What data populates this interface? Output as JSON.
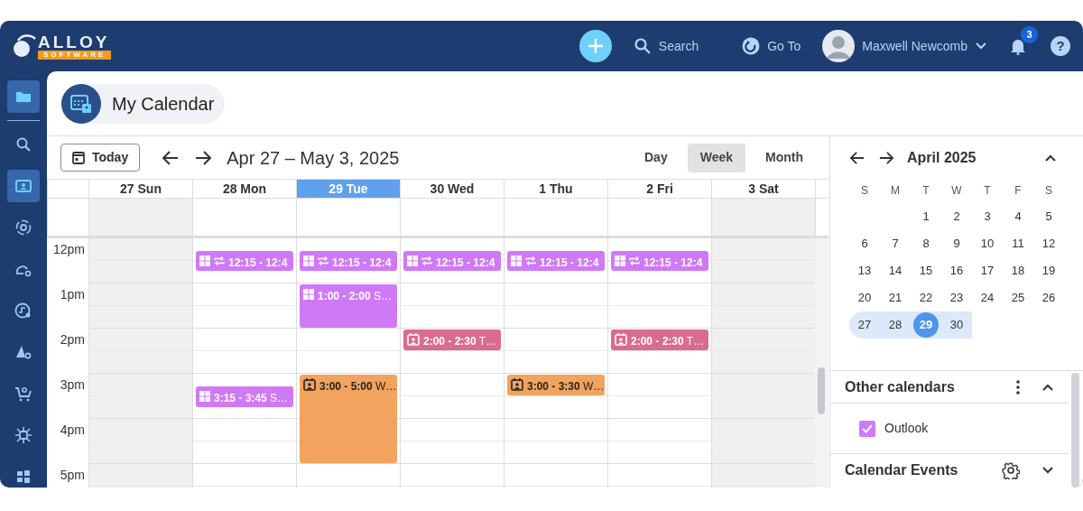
{
  "logo": {
    "word": "ALLOY",
    "tagline": "SOFTWARE"
  },
  "topbar": {
    "search": "Search",
    "goto": "Go To",
    "user": "Maxwell Newcomb",
    "notifications": "3",
    "help": "?"
  },
  "sidebar": {
    "items": [
      {
        "selected": true
      },
      {
        "selected": false
      },
      {
        "selected": true
      },
      {
        "selected": false
      },
      {
        "selected": false
      },
      {
        "selected": false
      },
      {
        "selected": false
      },
      {
        "selected": false
      },
      {
        "selected": false
      },
      {
        "selected": false
      }
    ]
  },
  "page_title": "My Calendar",
  "toolbar": {
    "today": "Today",
    "range": "Apr 27 – May 3, 2025",
    "views": [
      {
        "label": "Day",
        "selected": false
      },
      {
        "label": "Week",
        "selected": true
      },
      {
        "label": "Month",
        "selected": false
      }
    ]
  },
  "week": {
    "hours": [
      "12pm",
      "1pm",
      "2pm",
      "3pm",
      "4pm",
      "5pm"
    ],
    "days": [
      {
        "label": "27 Sun",
        "selected": false,
        "weekend": true
      },
      {
        "label": "28 Mon",
        "selected": false,
        "weekend": false,
        "events": [
          {
            "kind": "outlook",
            "recurring": true,
            "time": "12:15 - 12:4",
            "color": "#cf79f7"
          },
          {
            "kind": "outlook",
            "recurring": false,
            "time": "3:15 - 3:45",
            "title": "S…",
            "color": "#cf79f7"
          }
        ]
      },
      {
        "label": "29 Tue",
        "selected": true,
        "weekend": false,
        "events": [
          {
            "kind": "outlook",
            "recurring": true,
            "time": "12:15 - 12:4",
            "color": "#cf79f7"
          },
          {
            "kind": "outlook",
            "recurring": false,
            "time": "1:00 - 2:00",
            "title": "S…",
            "color": "#cf79f7"
          },
          {
            "kind": "meeting",
            "recurring": false,
            "time": "3:00 - 5:00",
            "title": "W…",
            "color": "#f2a35e"
          }
        ]
      },
      {
        "label": "30 Wed",
        "selected": false,
        "weekend": false,
        "events": [
          {
            "kind": "outlook",
            "recurring": true,
            "time": "12:15 - 12:4",
            "color": "#cf79f7"
          },
          {
            "kind": "meeting",
            "recurring": false,
            "time": "2:00 - 2:30",
            "title": "T…",
            "color": "#d96b8e"
          }
        ]
      },
      {
        "label": "1 Thu",
        "selected": false,
        "weekend": false,
        "events": [
          {
            "kind": "outlook",
            "recurring": true,
            "time": "12:15 - 12:4",
            "color": "#cf79f7"
          },
          {
            "kind": "meeting",
            "recurring": false,
            "time": "3:00 - 3:30",
            "title": "W…",
            "color": "#f2a35e"
          }
        ]
      },
      {
        "label": "2 Fri",
        "selected": false,
        "weekend": false,
        "events": [
          {
            "kind": "outlook",
            "recurring": true,
            "time": "12:15 - 12:4",
            "color": "#cf79f7"
          },
          {
            "kind": "meeting",
            "recurring": false,
            "time": "2:00 - 2:30",
            "title": "T…",
            "color": "#d96b8e"
          }
        ]
      },
      {
        "label": "3 Sat",
        "selected": false,
        "weekend": true
      }
    ]
  },
  "mini_calendar": {
    "title": "April 2025",
    "expanded": true,
    "weekdays": [
      "S",
      "M",
      "T",
      "W",
      "T",
      "F",
      "S"
    ],
    "weeks": [
      {
        "highlighted": false,
        "days": [
          {
            "label": "1",
            "selected": false
          },
          {
            "label": "2",
            "selected": false
          },
          {
            "label": "3",
            "selected": false
          },
          {
            "label": "4",
            "selected": false
          },
          {
            "label": "5",
            "selected": false
          }
        ]
      },
      {
        "highlighted": false,
        "days": [
          {
            "label": "6",
            "selected": false
          },
          {
            "label": "7",
            "selected": false
          },
          {
            "label": "8",
            "selected": false
          },
          {
            "label": "9",
            "selected": false
          },
          {
            "label": "10",
            "selected": false
          },
          {
            "label": "11",
            "selected": false
          },
          {
            "label": "12",
            "selected": false
          }
        ]
      },
      {
        "highlighted": false,
        "days": [
          {
            "label": "13",
            "selected": false
          },
          {
            "label": "14",
            "selected": false
          },
          {
            "label": "15",
            "selected": false
          },
          {
            "label": "16",
            "selected": false
          },
          {
            "label": "17",
            "selected": false
          },
          {
            "label": "18",
            "selected": false
          },
          {
            "label": "19",
            "selected": false
          }
        ]
      },
      {
        "highlighted": false,
        "days": [
          {
            "label": "20",
            "selected": false
          },
          {
            "label": "21",
            "selected": false
          },
          {
            "label": "22",
            "selected": false
          },
          {
            "label": "23",
            "selected": false
          },
          {
            "label": "24",
            "selected": false
          },
          {
            "label": "25",
            "selected": false
          },
          {
            "label": "26",
            "selected": false
          }
        ]
      },
      {
        "highlighted": true,
        "days": [
          {
            "label": "27",
            "selected": false
          },
          {
            "label": "28",
            "selected": false
          },
          {
            "label": "29",
            "selected": true
          },
          {
            "label": "30",
            "selected": false
          }
        ]
      }
    ]
  },
  "other_calendars": {
    "title": "Other calendars",
    "expanded": true,
    "items": [
      {
        "label": "Outlook",
        "checked": true,
        "color": "#cf79f7"
      }
    ]
  },
  "calendar_events": {
    "title": "Calendar Events",
    "expanded": false
  }
}
